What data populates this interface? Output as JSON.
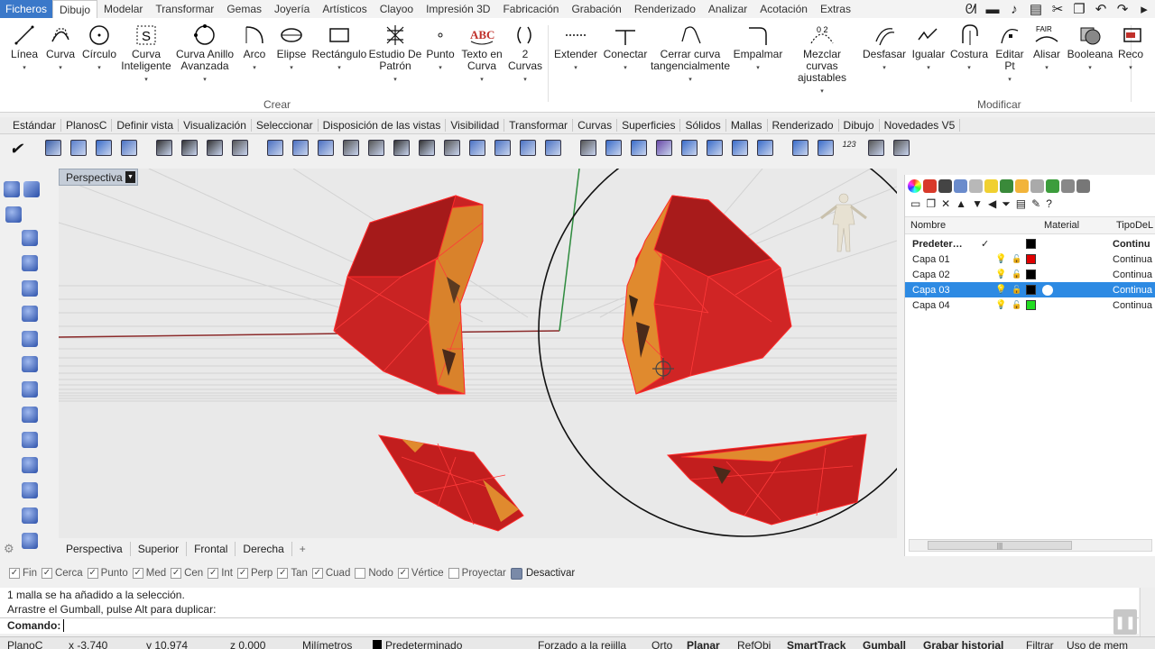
{
  "menu": {
    "file": "Ficheros",
    "tabs": [
      "Dibujo",
      "Modelar",
      "Transformar",
      "Gemas",
      "Joyería",
      "Artísticos",
      "Clayoo",
      "Impresión 3D",
      "Fabricación",
      "Grabación",
      "Renderizado",
      "Analizar",
      "Acotación",
      "Extras"
    ],
    "active_tab": "Dibujo"
  },
  "ribbon": {
    "buttons": [
      "Línea",
      "Curva",
      "Círculo",
      "Curva\nInteligente",
      "Curva Anillo\nAvanzada",
      "Arco",
      "Elipse",
      "Rectángulo",
      "Estudio De\nPatrón",
      "Punto",
      "Texto en\nCurva",
      "2\nCurvas",
      "Extender",
      "Conectar",
      "Cerrar curva\ntangencialmente",
      "Empalmar",
      "Mezclar curvas\najustables",
      "Desfasar",
      "Igualar",
      "Costura",
      "Editar\nPt",
      "Alisar",
      "Booleana",
      "Reco"
    ],
    "fair_label": "FAIR",
    "abc_label": "ABC",
    "num_label": "0 2",
    "group_crear": "Crear",
    "group_modificar": "Modificar"
  },
  "toolbar_tabs": [
    "Estándar",
    "PlanosC",
    "Definir vista",
    "Visualización",
    "Seleccionar",
    "Disposición de las vistas",
    "Visibilidad",
    "Transformar",
    "Curvas",
    "Superficies",
    "Sólidos",
    "Mallas",
    "Renderizado",
    "Dibujo",
    "Novedades V5"
  ],
  "toolbar_label_123": "123",
  "viewport": {
    "name": "Perspectiva",
    "tabs": [
      "Perspectiva",
      "Superior",
      "Frontal",
      "Derecha"
    ],
    "add_tab": "+"
  },
  "layers": {
    "columns": {
      "name": "Nombre",
      "material": "Material",
      "linetype": "TipoDeL"
    },
    "rows": [
      {
        "name": "Predeter…",
        "check": "✓",
        "color": "#000000",
        "linetype": "Continu",
        "selected": false
      },
      {
        "name": "Capa 01",
        "color": "#e00000",
        "linetype": "Continua",
        "selected": false
      },
      {
        "name": "Capa 02",
        "color": "#000000",
        "linetype": "Continua",
        "selected": false
      },
      {
        "name": "Capa 03",
        "color": "#000000",
        "linetype": "Continua",
        "selected": true
      },
      {
        "name": "Capa 04",
        "color": "#22dd22",
        "linetype": "Continua",
        "selected": false
      }
    ]
  },
  "osnaps": [
    {
      "label": "Fin",
      "checked": true
    },
    {
      "label": "Cerca",
      "checked": true
    },
    {
      "label": "Punto",
      "checked": true
    },
    {
      "label": "Med",
      "checked": true
    },
    {
      "label": "Cen",
      "checked": true
    },
    {
      "label": "Int",
      "checked": true
    },
    {
      "label": "Perp",
      "checked": true
    },
    {
      "label": "Tan",
      "checked": true
    },
    {
      "label": "Cuad",
      "checked": true
    },
    {
      "label": "Nodo",
      "checked": false
    },
    {
      "label": "Vértice",
      "checked": true
    },
    {
      "label": "Proyectar",
      "checked": false
    },
    {
      "label": "Desactivar",
      "checked": false
    }
  ],
  "command": {
    "history_1": "1 malla se ha añadido a la selección.",
    "history_2": "Arrastre el Gumball, pulse Alt para duplicar:",
    "prompt": "Comando:"
  },
  "status": {
    "cplane": "PlanoC",
    "x": "x -3.740",
    "y": "y 10.974",
    "z": "z 0.000",
    "units": "Milímetros",
    "layer": "Predeterminado",
    "grid": "Forzado a la rejilla",
    "ortho": "Orto",
    "planar": "Planar",
    "osnap": "RefObj",
    "smarttrack": "SmartTrack",
    "gumball": "Gumball",
    "history": "Grabar historial",
    "filter": "Filtrar",
    "memory": "Uso de mem"
  },
  "colors": {
    "accent": "#2d8ae3",
    "mesh_red": "#d42020",
    "mesh_orange": "#e98a2c",
    "file_tab": "#3a78c9"
  }
}
